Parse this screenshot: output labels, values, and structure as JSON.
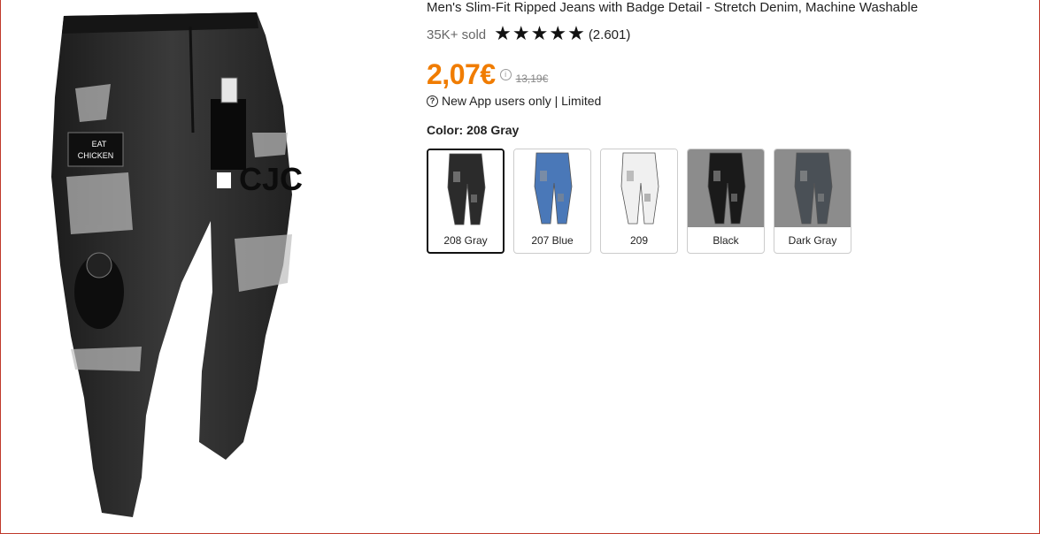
{
  "product": {
    "title": "Men's Slim-Fit Ripped Jeans with Badge Detail - Stretch Denim, Machine Washable",
    "sold": "35K+ sold",
    "rating_stars": 4.8,
    "reviews": "(2.601)",
    "price": "2,07€",
    "old_price": "13,19€",
    "promo": "New App users only | Limited",
    "color_label": "Color: 208 Gray",
    "hero_patch_text": [
      "EAT",
      "CHICKEN"
    ],
    "hero_brand_text": "CJC"
  },
  "variants": [
    {
      "label": "208 Gray",
      "selected": true,
      "color": "#2b2b2b"
    },
    {
      "label": "207 Blue",
      "selected": false,
      "color": "#4a78b8"
    },
    {
      "label": "209",
      "selected": false,
      "color": "#f0f0f0"
    },
    {
      "label": "Black",
      "selected": false,
      "color": "#1a1a1a"
    },
    {
      "label": "Dark Gray",
      "selected": false,
      "color": "#4a5056"
    }
  ],
  "colors": {
    "accent": "#f07c00",
    "text": "#222222",
    "muted": "#888888",
    "border": "#cccccc"
  },
  "icons": [
    "star-icon",
    "info-icon",
    "question-icon"
  ]
}
